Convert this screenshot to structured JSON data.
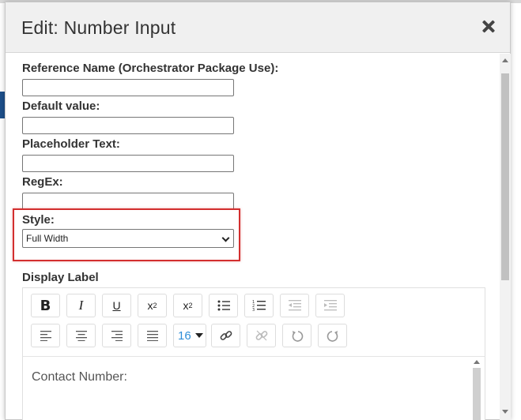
{
  "dialog": {
    "title": "Edit: Number Input"
  },
  "form": {
    "reference_name_label": "Reference Name (Orchestrator Package Use):",
    "reference_name_value": "",
    "default_value_label": "Default value:",
    "default_value_value": "",
    "placeholder_label": "Placeholder Text:",
    "placeholder_value": "",
    "regex_label": "RegEx:",
    "regex_value": "",
    "style_label": "Style:",
    "style_selected": "Full Width",
    "display_label_heading": "Display Label"
  },
  "editor": {
    "font_size": "16",
    "content": "Contact Number:",
    "toolbar_icons": [
      "bold-icon",
      "italic-icon",
      "underline-icon",
      "superscript-icon",
      "subscript-icon",
      "bullet-list-icon",
      "numbered-list-icon",
      "outdent-icon",
      "indent-icon",
      "align-left-icon",
      "align-center-icon",
      "align-right-icon",
      "justify-icon",
      "font-size-dropdown",
      "link-icon",
      "unlink-icon",
      "undo-icon",
      "redo-icon"
    ]
  },
  "colors": {
    "highlight": "#d32f2f",
    "font_size_accent": "#2f8fd8"
  }
}
